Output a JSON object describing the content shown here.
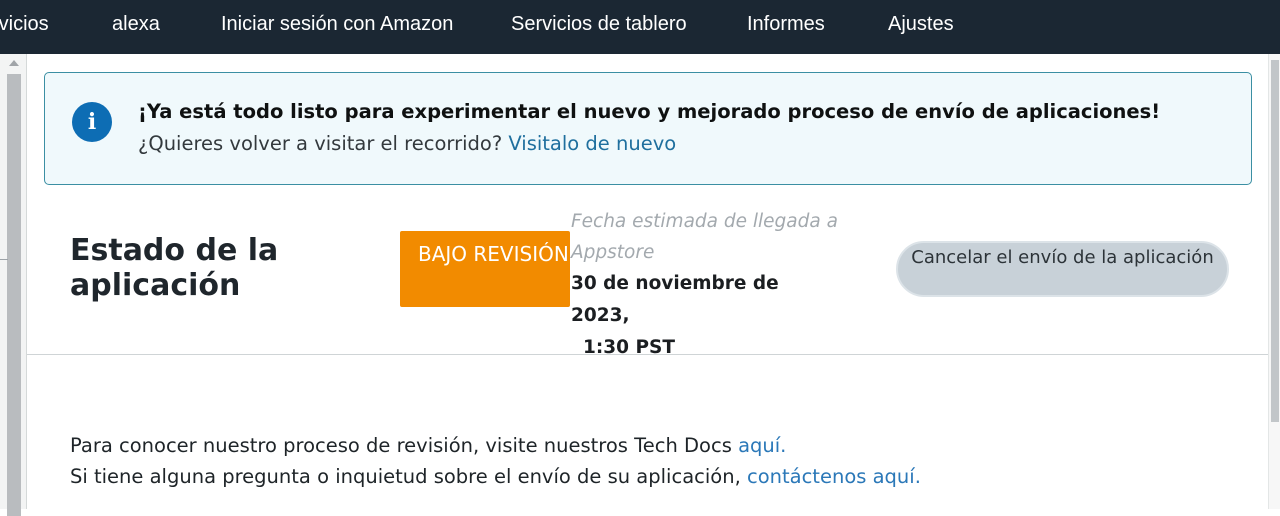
{
  "nav": {
    "items": [
      {
        "label": "rvicios"
      },
      {
        "label": "alexa"
      },
      {
        "label": "Iniciar sesión con Amazon"
      },
      {
        "label": "Servicios de tablero"
      },
      {
        "label": "Informes"
      },
      {
        "label": "Ajustes"
      }
    ]
  },
  "banner": {
    "icon": "info-icon",
    "icon_glyph": "i",
    "title": "¡Ya está todo listo para experimentar el nuevo y mejorado proceso de envío de aplicaciones!",
    "subtitle": "¿Quieres volver a visitar el recorrido?",
    "link_label": "Visitalo de nuevo"
  },
  "status": {
    "title": "Estado de la aplicación",
    "badge": "BAJO REVISIÓN",
    "eta_label": "Fecha estimada de llegada a Appstore",
    "eta_date": "30 de noviembre de 2023,",
    "eta_time": "1:30 PST",
    "cancel_label": "Cancelar el envío de la aplicación"
  },
  "help": {
    "line1_text": "Para conocer nuestro proceso de revisión, visite nuestros Tech Docs",
    "line1_link": "aquí.",
    "line2_text": "Si tiene alguna pregunta o inquietud sobre el envío de su aplicación,",
    "line2_link": "contáctenos aquí."
  },
  "colors": {
    "nav_bg": "#1b2733",
    "banner_bg": "#f0f9fc",
    "banner_border": "#3b8fa3",
    "info_icon": "#0d6db4",
    "badge_bg": "#f28b00",
    "cancel_bg": "#c8d1d8",
    "link": "#2b78b8"
  }
}
